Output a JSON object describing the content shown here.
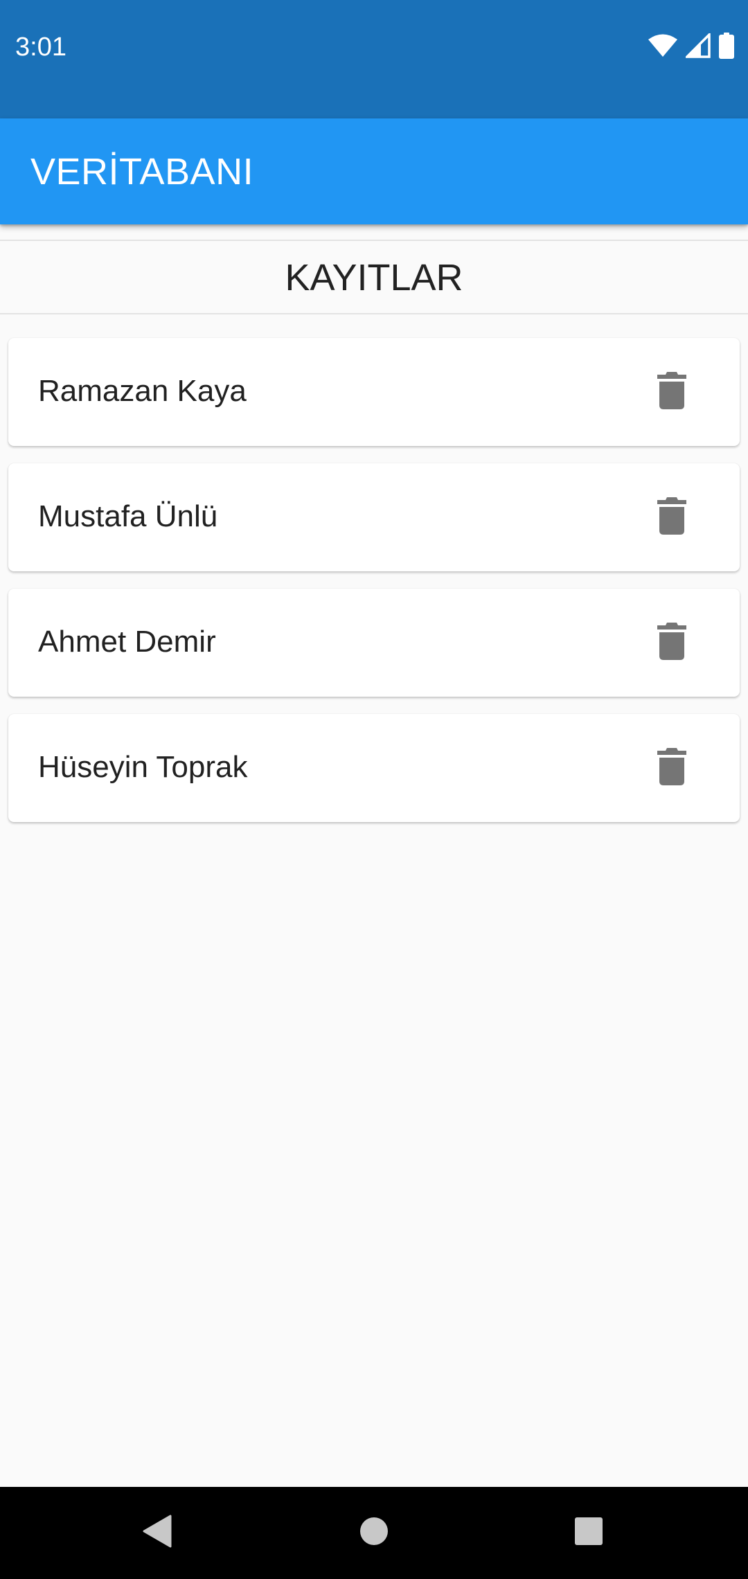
{
  "status_bar": {
    "time": "3:01",
    "icons": [
      "wifi-icon",
      "signal-icon",
      "battery-icon"
    ]
  },
  "app_bar": {
    "title": "VERİTABANI"
  },
  "section": {
    "title": "KAYITLAR"
  },
  "records": [
    {
      "name": "Ramazan Kaya",
      "action_icon": "trash-icon"
    },
    {
      "name": "Mustafa Ünlü",
      "action_icon": "trash-icon"
    },
    {
      "name": "Ahmet Demir",
      "action_icon": "trash-icon"
    },
    {
      "name": "Hüseyin Toprak",
      "action_icon": "trash-icon"
    }
  ],
  "nav_bar": {
    "buttons": [
      "back-icon",
      "home-icon",
      "recents-icon"
    ]
  },
  "colors": {
    "status_bar": "#1a71b8",
    "app_bar": "#2196f3",
    "background": "#fafafa",
    "card": "#ffffff",
    "icon_gray": "#757575"
  }
}
